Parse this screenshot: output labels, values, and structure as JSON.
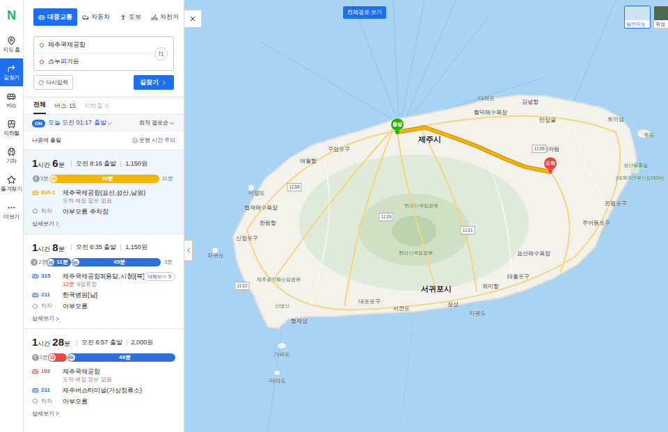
{
  "logo": "N",
  "nav": [
    {
      "label": "지도 홈",
      "selected": false
    },
    {
      "label": "길찾기",
      "selected": true
    },
    {
      "label": "버스",
      "selected": false
    },
    {
      "label": "지하철",
      "selected": false
    },
    {
      "label": "기차",
      "selected": false
    },
    {
      "label": "즐겨찾기",
      "selected": false
    },
    {
      "label": "더보기",
      "selected": false
    }
  ],
  "mode_tabs": [
    {
      "label": "대중교통",
      "selected": true
    },
    {
      "label": "자동차",
      "selected": false
    },
    {
      "label": "도보",
      "selected": false
    },
    {
      "label": "자전거",
      "selected": false
    }
  ],
  "origin": "제주국제공항",
  "destination": "스누피가든",
  "reset_button": "다시입력",
  "search_button": "길찾기",
  "filter_tabs": [
    {
      "label": "전체",
      "count": "",
      "selected": true,
      "disabled": false
    },
    {
      "label": "버스",
      "count": "15",
      "selected": false,
      "disabled": false
    },
    {
      "label": "지하철",
      "count": "0",
      "selected": false,
      "disabled": true
    }
  ],
  "departure": {
    "badge": "ON",
    "on": true,
    "time": "오늘 오전 01:17 출발",
    "sort": "최적 경로순"
  },
  "later_button": "나중에 출발",
  "notice": "운행 시간 주의",
  "routes": [
    {
      "selected": true,
      "duration": [
        {
          "text": "1",
          "big": true
        },
        {
          "text": "시간",
          "big": false
        },
        {
          "text": "6",
          "big": true
        },
        {
          "text": "분",
          "big": false
        }
      ],
      "depart": "오전 8:16 출발",
      "fare": "1,150원",
      "segments": [
        {
          "kind": "walk",
          "label": "3분",
          "level": 0.12
        },
        {
          "kind": "bus",
          "label": "52분",
          "level": 0.77,
          "color": "#f5b400"
        },
        {
          "kind": "walk",
          "label": "11분",
          "level": 0.11
        }
      ],
      "steps": [
        {
          "kind": "bus",
          "number": "810-1",
          "color": "#f0a800",
          "stop": "제주국제공항(표선,성산,남원)",
          "info": [
            {
              "text": "도착 예정 정보 없음",
              "color": "#888888"
            }
          ],
          "badge": ""
        },
        {
          "kind": "alight",
          "number": "하차",
          "color": "#888888",
          "stop": "아부오름 주차장",
          "info": [],
          "badge": ""
        }
      ],
      "detail": "상세보기"
    },
    {
      "selected": false,
      "duration": [
        {
          "text": "1",
          "big": true
        },
        {
          "text": "시간",
          "big": false
        },
        {
          "text": "8",
          "big": true
        },
        {
          "text": "분",
          "big": false
        }
      ],
      "depart": "오전 6:35 출발",
      "fare": "1,150원",
      "segments": [
        {
          "kind": "walk",
          "label": "2분",
          "level": 0.1
        },
        {
          "kind": "bus",
          "label": "11분",
          "level": 0.17,
          "color": "#2f6fdc"
        },
        {
          "kind": "bus",
          "label": "45분",
          "level": 0.63,
          "color": "#2f6fdc"
        },
        {
          "kind": "walk",
          "label": "3분",
          "level": 0.1
        }
      ],
      "steps": [
        {
          "kind": "bus",
          "number": "315",
          "color": "#2f6fdc",
          "stop": "제주국제공항3(용담,시청)[북]",
          "info": [
            {
              "text": "12분",
              "color": "#e53935"
            },
            {
              "text": "6정류장",
              "color": "#888888"
            }
          ],
          "badge": "대체버스 5"
        },
        {
          "kind": "bus",
          "number": "211",
          "color": "#2f6fdc",
          "stop": "한국병원[남]",
          "info": [],
          "badge": ""
        },
        {
          "kind": "alight",
          "number": "하차",
          "color": "#888888",
          "stop": "아부오름",
          "info": [],
          "badge": ""
        }
      ],
      "detail": "상세보기"
    },
    {
      "selected": false,
      "duration": [
        {
          "text": "1",
          "big": true
        },
        {
          "text": "시간",
          "big": false
        },
        {
          "text": "28",
          "big": true
        },
        {
          "text": "분",
          "big": false
        }
      ],
      "depart": "오전 6:57 출발",
      "fare": "2,000원",
      "segments": [
        {
          "kind": "walk",
          "label": "3분",
          "level": 0.11
        },
        {
          "kind": "bus",
          "label": "",
          "level": 0.13,
          "color": "#e84a4a"
        },
        {
          "kind": "bus",
          "label": "49분",
          "level": 0.76,
          "color": "#2f6fdc"
        }
      ],
      "steps": [
        {
          "kind": "bus",
          "number": "102",
          "color": "#e84a4a",
          "stop": "제주국제공항",
          "info": [
            {
              "text": "도착 예정 정보 없음",
              "color": "#888888"
            }
          ],
          "badge": ""
        },
        {
          "kind": "bus",
          "number": "211",
          "color": "#2f6fdc",
          "stop": "제주버스터미널(가상정류소)",
          "info": [],
          "badge": ""
        },
        {
          "kind": "alight",
          "number": "하차",
          "color": "#888888",
          "stop": "아부오름",
          "info": [],
          "badge": ""
        }
      ],
      "detail": "상세보기"
    }
  ],
  "map": {
    "full_route_button": "전체경로 보기",
    "map_types": [
      {
        "label": "일반지도",
        "selected": true
      },
      {
        "label": "위성",
        "selected": false
      }
    ],
    "pins": [
      {
        "label": "출발",
        "color": "#2db400"
      },
      {
        "label": "도착",
        "color": "#f0413e"
      }
    ],
    "labels": [
      {
        "text": "다려도",
        "kind": "place"
      },
      {
        "text": "김녕항",
        "kind": "place"
      },
      {
        "text": "함덕해수욕장",
        "kind": "place"
      },
      {
        "text": "만장굴",
        "kind": "place"
      },
      {
        "text": "토끼섬",
        "kind": "place"
      },
      {
        "text": "우도",
        "kind": "place"
      },
      {
        "text": "비자림",
        "kind": "place"
      },
      {
        "text": "성산일출봉",
        "kind": "park"
      },
      {
        "text": "(세계자연유산)(182m)",
        "kind": "park"
      },
      {
        "text": "제주시",
        "kind": "city"
      },
      {
        "text": "구엄포구",
        "kind": "place"
      },
      {
        "text": "애월항",
        "kind": "place"
      },
      {
        "text": "1136",
        "kind": "road"
      },
      {
        "text": "비양도",
        "kind": "place"
      },
      {
        "text": "협재해수욕장",
        "kind": "place"
      },
      {
        "text": "한림항",
        "kind": "place"
      },
      {
        "text": "신창포구",
        "kind": "place"
      },
      {
        "text": "차귀도",
        "kind": "place"
      },
      {
        "text": "1139",
        "kind": "road"
      },
      {
        "text": "한라산국립공원",
        "kind": "park"
      },
      {
        "text": "한라산국립공원",
        "kind": "park"
      },
      {
        "text": "1131",
        "kind": "road"
      },
      {
        "text": "1136",
        "kind": "road"
      },
      {
        "text": "제주곶자왈도립공원",
        "kind": "park"
      },
      {
        "text": "1132",
        "kind": "road"
      },
      {
        "text": "서귀포시",
        "kind": "city"
      },
      {
        "text": "산방산",
        "kind": "park"
      },
      {
        "text": "형제섬",
        "kind": "place"
      },
      {
        "text": "가파도",
        "kind": "place"
      },
      {
        "text": "마라도",
        "kind": "place"
      },
      {
        "text": "대포포구",
        "kind": "place"
      },
      {
        "text": "서건도",
        "kind": "place"
      },
      {
        "text": "섶섬",
        "kind": "place"
      },
      {
        "text": "지귀도",
        "kind": "place"
      },
      {
        "text": "위미항",
        "kind": "place"
      },
      {
        "text": "표선해수욕장",
        "kind": "place"
      },
      {
        "text": "태흥포구",
        "kind": "place"
      },
      {
        "text": "온평포구",
        "kind": "place"
      },
      {
        "text": "주어동포구",
        "kind": "place"
      }
    ]
  }
}
